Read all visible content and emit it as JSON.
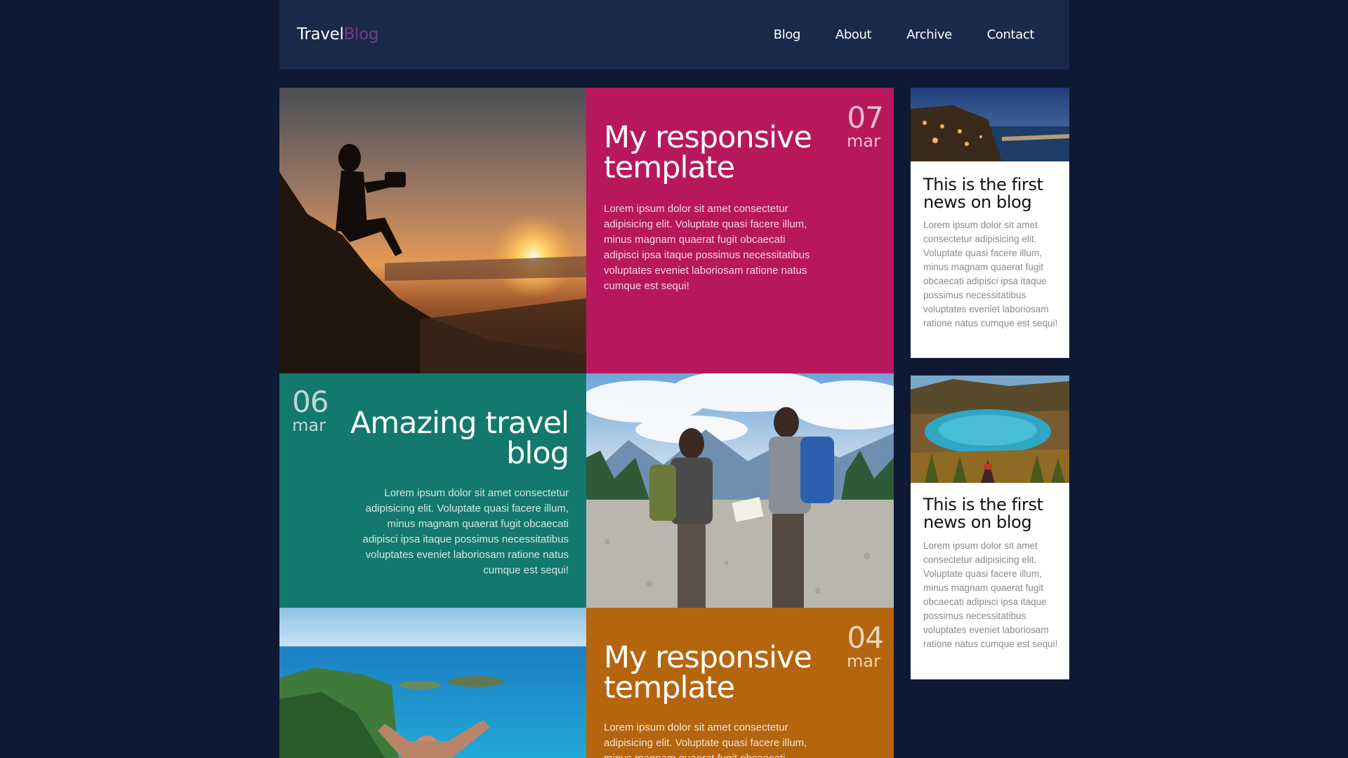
{
  "header": {
    "logo_main": "Travel",
    "logo_accent": "Blog",
    "nav": [
      "Blog",
      "About",
      "Archive",
      "Contact"
    ]
  },
  "posts": [
    {
      "title_line1": "My responsive",
      "title_line2": "template",
      "day": "07",
      "month": "mar",
      "excerpt": "Lorem ipsum dolor sit amet consectetur adipisicing elit. Voluptate quasi facere illum, minus magnam quaerat fugit obcaecati adipisci ipsa itaque possimus necessitatibus voluptates eveniet laboriosam ratione natus cumque est sequi!",
      "color": "#b8175e",
      "image": "photographer-sunset-image"
    },
    {
      "title_line1": "Amazing travel",
      "title_line2": "blog",
      "day": "06",
      "month": "mar",
      "excerpt": "Lorem ipsum dolor sit amet consectetur adipisicing elit. Voluptate quasi facere illum, minus magnam quaerat fugit obcaecati adipisci ipsa itaque possimus necessitatibus voluptates eveniet laboriosam ratione natus cumque est sequi!",
      "color": "#13786d",
      "image": "hikers-map-image"
    },
    {
      "title_line1": "My responsive",
      "title_line2": "template",
      "day": "04",
      "month": "mar",
      "excerpt": "Lorem ipsum dolor sit amet consectetur adipisicing elit. Voluptate quasi facere illum, minus magnam quaerat fugit obcaecati",
      "color": "#b5650e",
      "image": "island-view-image"
    }
  ],
  "sidebar": [
    {
      "title_line1": "This is the first",
      "title_line2": "news on blog",
      "excerpt": "Lorem ipsum dolor sit amet consectetur adipisicing elit. Voluptate quasi facere illum, minus magnam quaerat fugit obcaecati adipisci ipsa itaque possimus necessitatibus voluptates eveniet laboriosam ratione natus cumque est sequi!",
      "image": "resort-night-image"
    },
    {
      "title_line1": "This is the first",
      "title_line2": "news on blog",
      "excerpt": "Lorem ipsum dolor sit amet consectetur adipisicing elit. Voluptate quasi facere illum, minus magnam quaerat fugit obcaecati adipisci ipsa itaque possimus necessitatibus voluptates eveniet laboriosam ratione natus cumque est sequi!",
      "image": "mountain-lake-image"
    }
  ]
}
